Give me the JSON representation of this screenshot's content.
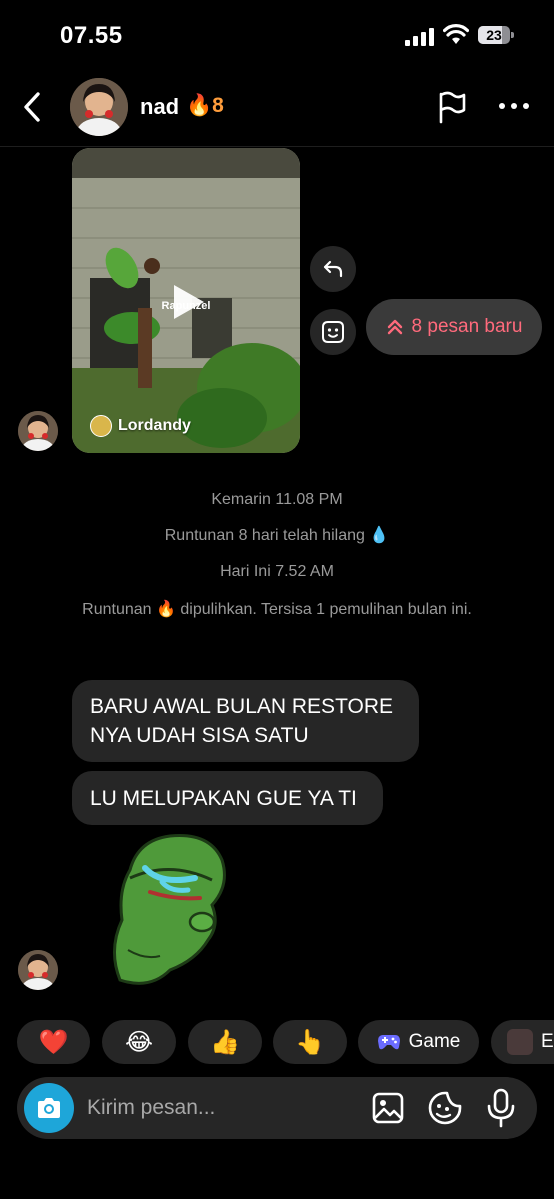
{
  "status_bar": {
    "time": "07.55",
    "battery": "23"
  },
  "header": {
    "name": "nad",
    "streak": "🔥8"
  },
  "video": {
    "title": "Rapunzel",
    "author": "Lordandy"
  },
  "new_messages": {
    "label": "8 pesan baru"
  },
  "system_messages": {
    "time_1": "Kemarin 11.08 PM",
    "streak_lost": "Runtunan 8 hari telah hilang 💧",
    "time_2": "Hari Ini 7.52 AM",
    "restore": "Runtunan 🔥 dipulihkan. Tersisa 1 pemulihan bulan ini."
  },
  "messages": [
    {
      "text": "BARU AWAL BULAN RESTORE NYA UDAH SISA SATU"
    },
    {
      "text": "LU MELUPAKAN GUE YA TI"
    }
  ],
  "quick_reactions": {
    "heart": "❤️",
    "laugh": "😂",
    "thumb": "👍",
    "point": "👆",
    "game_label": "Game",
    "last_label": "E"
  },
  "composer": {
    "placeholder": "Kirim pesan..."
  },
  "colors": {
    "accent_pink": "#ff6a7c",
    "streak_orange": "#ff9d3c",
    "camera_blue": "#1ea6d9"
  }
}
